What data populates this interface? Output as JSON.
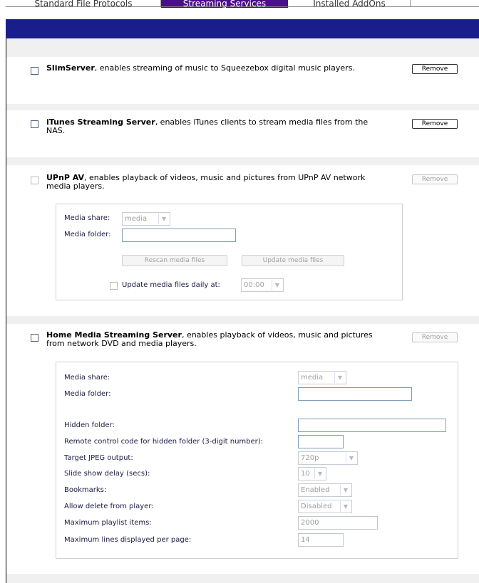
{
  "tabs": [
    {
      "label": "Standard File Protocols",
      "active": false
    },
    {
      "label": "Streaming Services",
      "active": true
    },
    {
      "label": "Installed AddOns",
      "active": false
    }
  ],
  "colors": {
    "tab_active": "#4a0f8c",
    "header_bar": "#1a1d8c",
    "page_bg": "#f0f0f0"
  },
  "services": {
    "slim": {
      "name": "SlimServer",
      "desc": ", enables streaming of music to Squeezebox digital music players.",
      "remove": "Remove",
      "checked": false
    },
    "itunes": {
      "name": "iTunes Streaming Server",
      "desc": ", enables iTunes clients to stream media files from the NAS.",
      "remove": "Remove",
      "checked": false
    },
    "upnp": {
      "name": "UPnP AV",
      "desc": ", enables playback of videos, music and pictures from UPnP AV network media players.",
      "remove": "Remove",
      "checked": false,
      "media_share_label": "Media share:",
      "media_share_value": "media",
      "media_folder_label": "Media folder:",
      "media_folder_value": "",
      "rescan": "Rescan media files",
      "update": "Update media files",
      "daily_label": "Update media files daily at:",
      "daily_time": "00:00",
      "daily_checked": false
    },
    "home": {
      "name": "Home Media Streaming Server",
      "desc": ", enables playback of videos, music and pictures from network DVD and media players.",
      "remove": "Remove",
      "checked": false,
      "fields": {
        "media_share": {
          "label": "Media share:",
          "value": "media"
        },
        "media_folder": {
          "label": "Media folder:",
          "value": ""
        },
        "hidden_folder": {
          "label": "Hidden folder:",
          "value": ""
        },
        "remote_code": {
          "label": "Remote control code for hidden folder (3-digit number):",
          "value": ""
        },
        "jpeg": {
          "label": "Target JPEG output:",
          "value": "720p"
        },
        "slide_delay": {
          "label": "Slide show delay (secs):",
          "value": "10"
        },
        "bookmarks": {
          "label": "Bookmarks:",
          "value": "Enabled"
        },
        "allow_delete": {
          "label": "Allow delete from player:",
          "value": "Disabled"
        },
        "max_playlist": {
          "label": "Maximum playlist items:",
          "value": "2000"
        },
        "max_lines": {
          "label": "Maximum lines displayed per page:",
          "value": "14"
        }
      }
    }
  }
}
